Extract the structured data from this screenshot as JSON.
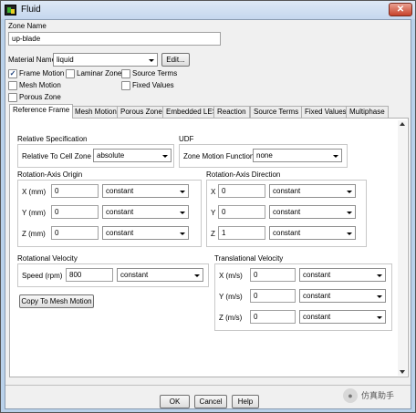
{
  "window": {
    "title": "Fluid",
    "close_glyph": "✕"
  },
  "zone_name": {
    "label": "Zone Name",
    "value": "up-blade"
  },
  "material": {
    "label": "Material Name",
    "value": "liquid",
    "edit_label": "Edit..."
  },
  "checkboxes": {
    "frame_motion": {
      "label": "Frame Motion",
      "checked": true
    },
    "laminar_zone": {
      "label": "Laminar Zone",
      "checked": false
    },
    "source_terms": {
      "label": "Source Terms",
      "checked": false
    },
    "mesh_motion": {
      "label": "Mesh Motion",
      "checked": false
    },
    "fixed_values": {
      "label": "Fixed Values",
      "checked": false
    },
    "porous_zone": {
      "label": "Porous Zone",
      "checked": false
    }
  },
  "check_glyph": "✓",
  "tabs": [
    "Reference Frame",
    "Mesh Motion",
    "Porous Zone",
    "Embedded LES",
    "Reaction",
    "Source Terms",
    "Fixed Values",
    "Multiphase"
  ],
  "active_tab": "Reference Frame",
  "relative_spec": {
    "label": "Relative Specification",
    "cell_zone_label": "Relative To Cell Zone",
    "cell_zone_value": "absolute"
  },
  "udf": {
    "label": "UDF",
    "zmf_label": "Zone Motion Function",
    "zmf_value": "none"
  },
  "origin": {
    "label": "Rotation-Axis Origin",
    "x": {
      "label": "X (mm)",
      "value": "0",
      "mode": "constant"
    },
    "y": {
      "label": "Y (mm)",
      "value": "0",
      "mode": "constant"
    },
    "z": {
      "label": "Z (mm)",
      "value": "0",
      "mode": "constant"
    }
  },
  "direction": {
    "label": "Rotation-Axis Direction",
    "x": {
      "label": "X",
      "value": "0",
      "mode": "constant"
    },
    "y": {
      "label": "Y",
      "value": "0",
      "mode": "constant"
    },
    "z": {
      "label": "Z",
      "value": "1",
      "mode": "constant"
    }
  },
  "rot_velocity": {
    "label": "Rotational Velocity",
    "speed_label": "Speed (rpm)",
    "speed_value": "800",
    "speed_mode": "constant",
    "copy_label": "Copy To Mesh Motion"
  },
  "trans_velocity": {
    "label": "Translational Velocity",
    "x": {
      "label": "X (m/s)",
      "value": "0",
      "mode": "constant"
    },
    "y": {
      "label": "Y (m/s)",
      "value": "0",
      "mode": "constant"
    },
    "z": {
      "label": "Z (m/s)",
      "value": "0",
      "mode": "constant"
    }
  },
  "buttons": {
    "ok": "OK",
    "cancel": "Cancel",
    "help": "Help"
  },
  "watermark": {
    "text": "仿真助手",
    "icon": "wechat-icon"
  }
}
